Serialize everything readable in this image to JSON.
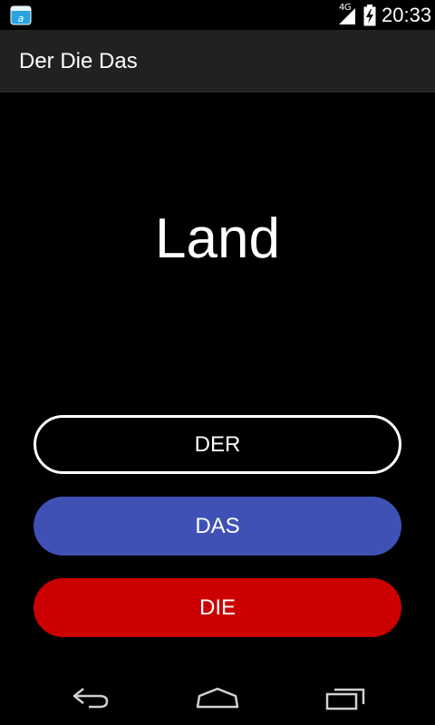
{
  "status_bar": {
    "network_type": "4G",
    "time": "20:33",
    "icons": [
      "app-notification-icon",
      "signal-icon",
      "battery-icon"
    ]
  },
  "action_bar": {
    "title": "Der Die Das"
  },
  "main": {
    "word": "Land",
    "buttons": [
      {
        "label": "DER",
        "color": "#000000",
        "border": "#ffffff"
      },
      {
        "label": "DAS",
        "color": "#3f51b5"
      },
      {
        "label": "DIE",
        "color": "#cc0000"
      }
    ]
  },
  "nav_bar": {
    "icons": [
      "back-icon",
      "home-icon",
      "recent-apps-icon"
    ]
  },
  "colors": {
    "background": "#000000",
    "action_bar": "#212121",
    "das_blue": "#3f51b5",
    "die_red": "#cc0000",
    "text": "#ffffff"
  }
}
